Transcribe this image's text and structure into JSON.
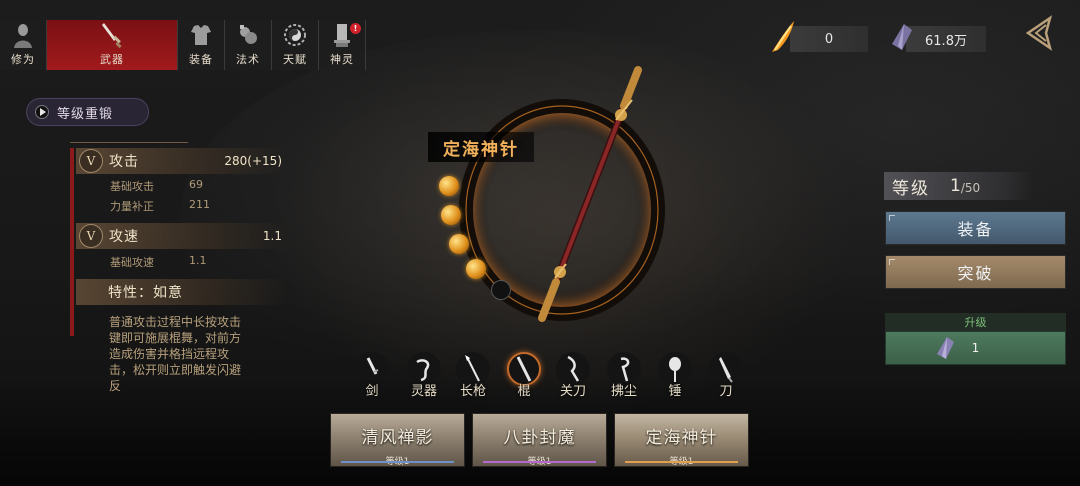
{
  "tabs": [
    {
      "label": "修为",
      "icon": "figure-icon"
    },
    {
      "label": "武器",
      "icon": "sword-icon",
      "active": true
    },
    {
      "label": "装备",
      "icon": "armor-icon"
    },
    {
      "label": "法术",
      "icon": "gourd-icon"
    },
    {
      "label": "天赋",
      "icon": "taiji-icon"
    },
    {
      "label": "神灵",
      "icon": "shrine-icon",
      "badge": "!"
    }
  ],
  "currencies": {
    "flame": {
      "value": "0",
      "icon": "flame-feather-icon"
    },
    "crystal": {
      "value": "61.8万",
      "icon": "crystal-icon"
    }
  },
  "reforge_label": "等级重锻",
  "attributes": {
    "attack": {
      "name": "攻击",
      "value": "280(+15)",
      "subs": [
        {
          "name": "基础攻击",
          "value": "69"
        },
        {
          "name": "力量补正",
          "value": "211"
        }
      ]
    },
    "speed": {
      "name": "攻速",
      "value": "1.1",
      "subs": [
        {
          "name": "基础攻速",
          "value": "1.1"
        }
      ]
    },
    "trait": {
      "name": "特性：如意"
    },
    "description": "普通攻击过程中长按攻击键即可施展棍舞，对前方造成伤害并格挡远程攻击，松开则立即触发闪避反"
  },
  "weapon": {
    "name": "定海神针",
    "orbs_filled": 4,
    "orbs_total": 5
  },
  "weapon_types": [
    "剑",
    "灵器",
    "长枪",
    "棍",
    "关刀",
    "拂尘",
    "锤",
    "刀"
  ],
  "selected_type": "棍",
  "skills": [
    {
      "name": "清风禅影",
      "level": "等级1",
      "bar_color": "#6f8fc8"
    },
    {
      "name": "八卦封魔",
      "level": "等级1",
      "bar_color": "#b36ad0"
    },
    {
      "name": "定海神针",
      "level": "等级1",
      "bar_color": "#e0a050"
    }
  ],
  "right": {
    "level_label": "等级",
    "level_value": "1",
    "level_max": "/50",
    "equip_label": "装备",
    "break_label": "突破",
    "upgrade_title": "升级",
    "upgrade_cost": "1"
  }
}
